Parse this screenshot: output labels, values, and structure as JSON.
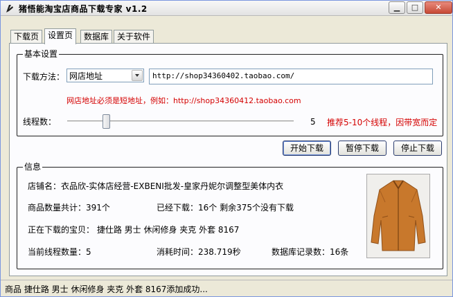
{
  "window": {
    "title": "猪悟能淘宝店商品下载专家 v1.2"
  },
  "tabs": [
    {
      "label": "下载页"
    },
    {
      "label": "设置页"
    },
    {
      "label": "数据库"
    },
    {
      "label": "关于软件"
    }
  ],
  "settings": {
    "group_title": "基本设置",
    "method_label": "下载方法：",
    "method_selected": "网店地址",
    "url_value": "http://shop34360402.taobao.com/",
    "hint": "网店地址必须是短地址，例如：http://shop34360412.taobao.com",
    "threads_label": "线程数：",
    "threads_value": "5",
    "threads_level": 0.16,
    "threads_hint": "推荐5-10个线程，因带宽而定"
  },
  "buttons": {
    "start": "开始下载",
    "pause": "暂停下载",
    "stop": "停止下载"
  },
  "info": {
    "group_title": "信息",
    "shop_name": "店铺名：衣品欣-实体店经营-EXBENI批发-皇家丹妮尔调整型美体内衣",
    "total": "商品数量共计：391个",
    "downloaded": "已经下载：16个  剩余375个没有下载",
    "current": "正在下载的宝贝： 捷仕路 男士 休闲修身 夹克 外套 8167",
    "thread_count": "当前线程数量：5",
    "elapsed": "消耗时间：238.719秒",
    "db_records": "数据库记录数：16条"
  },
  "status": {
    "text": "商品 捷仕路 男士 休闲修身 夹克 外套 8167添加成功..."
  },
  "colors": {
    "accent_red": "#d40000",
    "window_bg": "#ece9d8",
    "pane_bg": "#fcfcfe"
  }
}
